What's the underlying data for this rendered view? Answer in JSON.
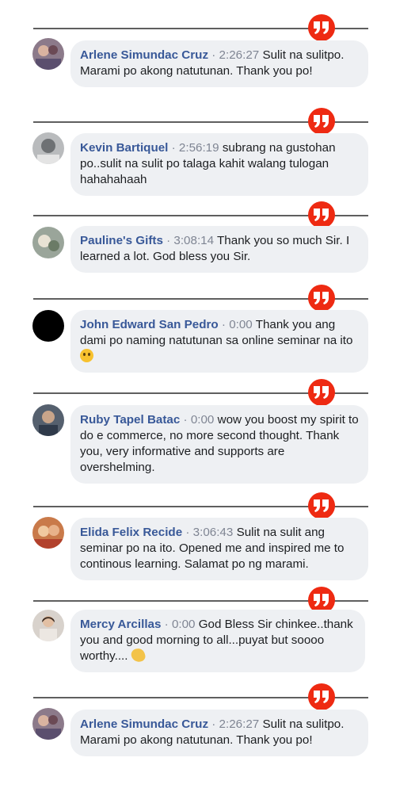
{
  "quote_glyph": "”",
  "testimonials": [
    {
      "name": "Arlene Simundac Cruz",
      "sep": " · ",
      "time": "2:26:27",
      "text": " Sulit na sulitpo. Marami po akong natutunan. Thank you po!"
    },
    {
      "name": "Kevin Bartiquel",
      "sep": " · ",
      "time": "2:56:19",
      "text": " subrang na gustohan po..sulit na sulit po talaga kahit walang tulogan hahahahaah"
    },
    {
      "name": "Pauline's Gifts",
      "sep": " · ",
      "time": "3:08:14",
      "text": " Thank you so much Sir. I learned a lot. God bless you Sir."
    },
    {
      "name": "John Edward San Pedro",
      "sep": " · ",
      "time": "0:00",
      "text": " Thank you ang dami po naming natutunan sa online seminar na ito ",
      "emoji": "smiling-face-emoji"
    },
    {
      "name": "Ruby Tapel Batac",
      "sep": " · ",
      "time": "0:00",
      "text": " wow you boost my spirit to do e commerce, no more second thought. Thank you, very informative and supports are overshelming."
    },
    {
      "name": "Elida Felix Recide",
      "sep": " · ",
      "time": "3:06:43",
      "text": " Sulit na sulit ang seminar po na ito. Opened me and inspired me to continous learning. Salamat po ng marami."
    },
    {
      "name": "Mercy Arcillas",
      "sep": " · ",
      "time": "0:00",
      "text": " God Bless Sir chinkee..thank you and good morning to all...puyat but soooo worthy.... ",
      "emoji": "clapping-hands-emoji"
    },
    {
      "name": "Arlene Simundac Cruz",
      "sep": " · ",
      "time": "2:26:27",
      "text": " Sulit na sulitpo. Marami po akong natutunan. Thank you po!"
    }
  ],
  "colors": {
    "accent": "#ee2a12",
    "name": "#385898",
    "time": "#7f8593",
    "bubble": "#eef0f3",
    "divider": "#5f5f5f"
  }
}
